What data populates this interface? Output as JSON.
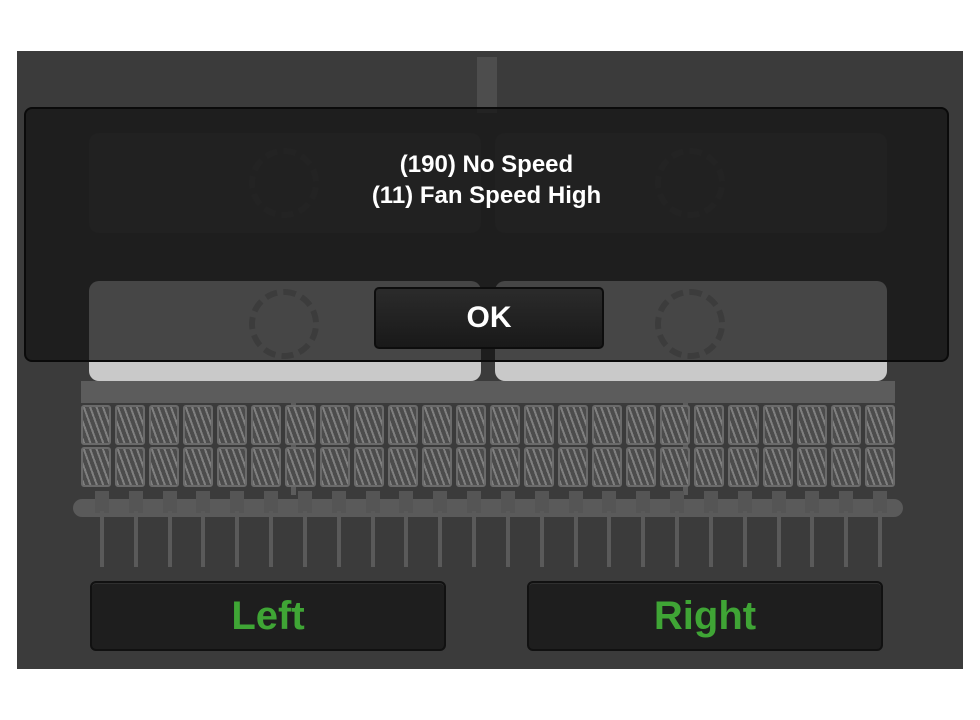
{
  "dialog": {
    "line1": "(190) No Speed",
    "line2": "(11) Fan Speed High",
    "ok_label": "OK"
  },
  "buttons": {
    "left_label": "Left",
    "right_label": "Right"
  },
  "colors": {
    "accent_green": "#3fa535",
    "screen_bg": "#3b3b3b",
    "dialog_text": "#ffffff"
  },
  "icons": {
    "fan": "fan-icon"
  },
  "implement": {
    "row_count": 24
  }
}
